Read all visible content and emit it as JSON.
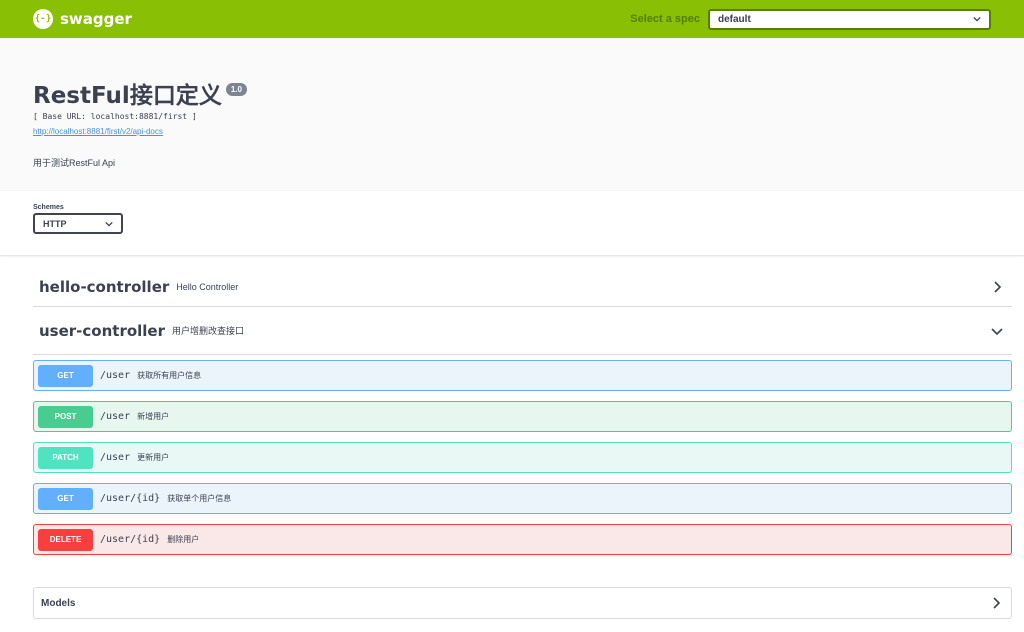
{
  "topbar": {
    "logo_icon": "{-}",
    "logo_text": "swagger",
    "spec_label": "Select a spec",
    "spec_value": "default",
    "bg_color": "#89bf04"
  },
  "info": {
    "title": "RestFul接口定义",
    "version": "1.0",
    "base_url": "[ Base URL: localhost:8881/first ]",
    "docs_link": "http://localhost:8881/first/v2/api-docs",
    "description": "用于测试RestFul Api"
  },
  "schemes": {
    "label": "Schemes",
    "value": "HTTP"
  },
  "tags": [
    {
      "name": "hello-controller",
      "description": "Hello Controller",
      "icon": "chevron-right-icon"
    },
    {
      "name": "user-controller",
      "description": "用户增删改查接口",
      "icon": "chevron-down-icon"
    }
  ],
  "operations": [
    {
      "method": "GET",
      "path": "/user",
      "summary": "获取所有用户信息",
      "color": "#61affe"
    },
    {
      "method": "POST",
      "path": "/user",
      "summary": "新增用户",
      "color": "#49cc90"
    },
    {
      "method": "PATCH",
      "path": "/user",
      "summary": "更新用户",
      "color": "#50e3c2"
    },
    {
      "method": "GET",
      "path": "/user/{id}",
      "summary": "获取单个用户信息",
      "color": "#61affe"
    },
    {
      "method": "DELETE",
      "path": "/user/{id}",
      "summary": "删除用户",
      "color": "#f93e3e"
    }
  ],
  "models": {
    "label": "Models",
    "icon": "chevron-right-icon"
  }
}
